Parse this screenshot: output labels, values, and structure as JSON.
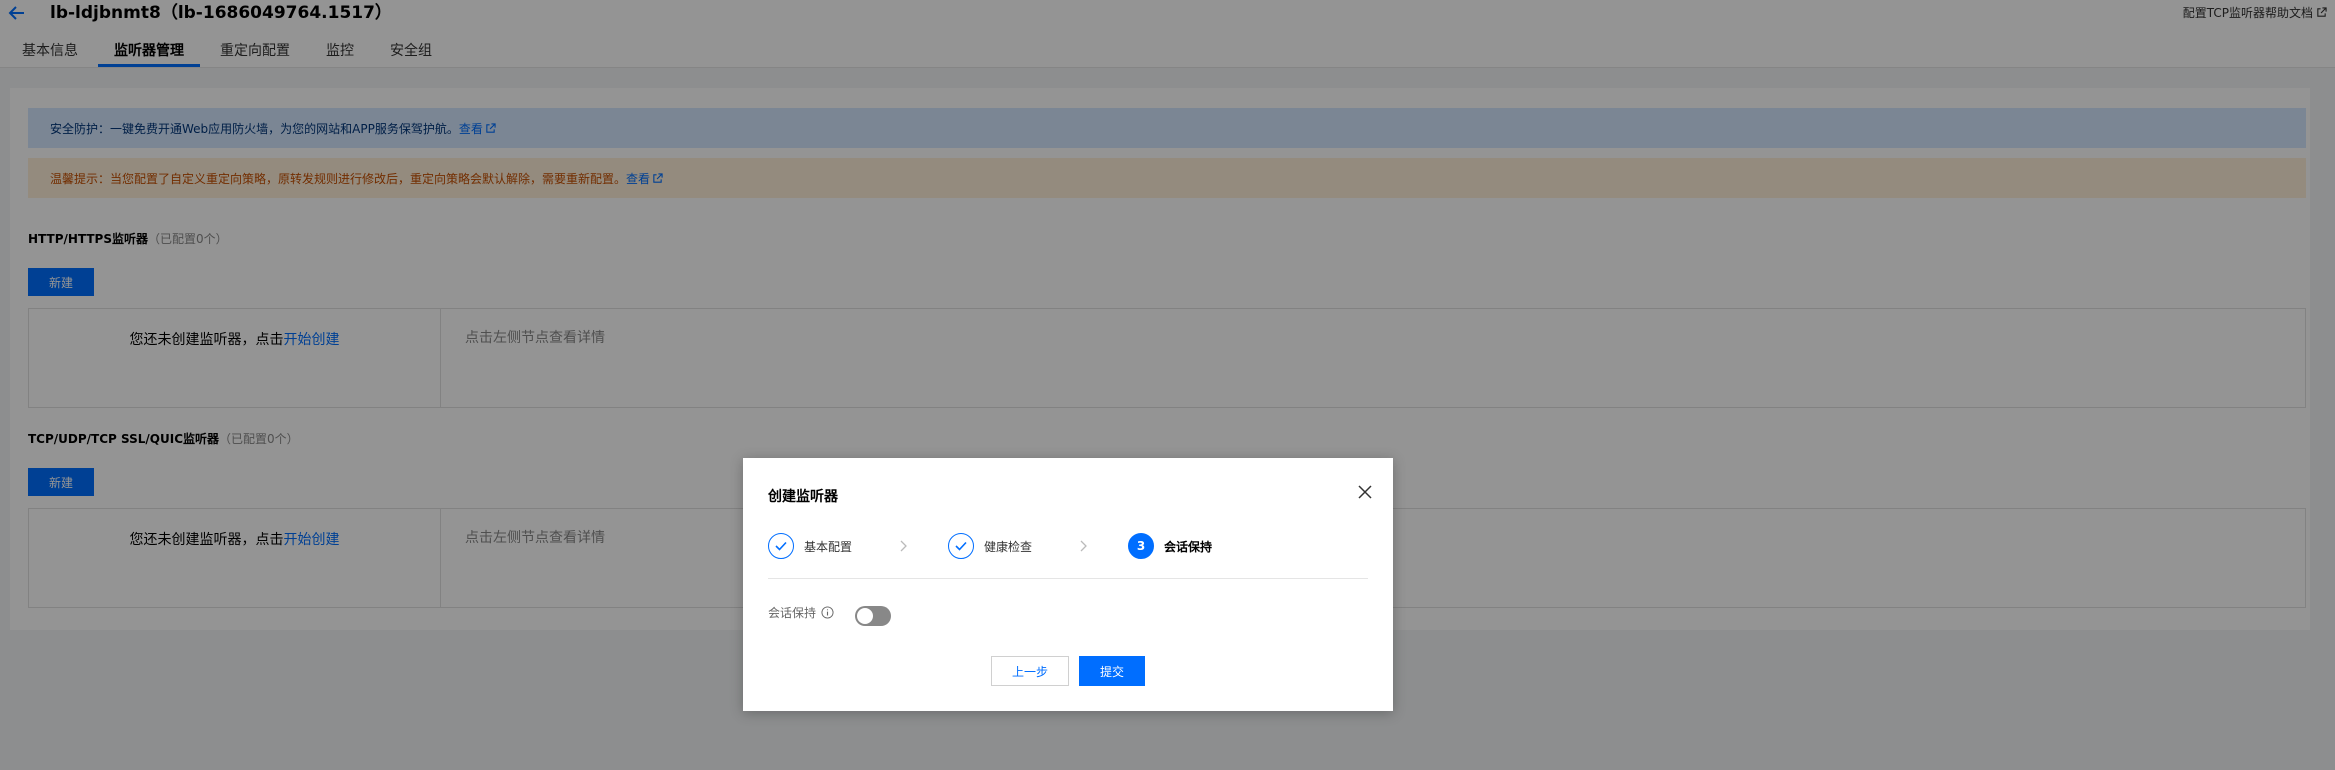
{
  "header": {
    "title": "lb-ldjbnmt8（lb-1686049764.1517）",
    "help_link": "配置TCP监听器帮助文档"
  },
  "tabs": [
    {
      "label": "基本信息",
      "active": false
    },
    {
      "label": "监听器管理",
      "active": true
    },
    {
      "label": "重定向配置",
      "active": false
    },
    {
      "label": "监控",
      "active": false
    },
    {
      "label": "安全组",
      "active": false
    }
  ],
  "alerts": {
    "info_text": "安全防护：一键免费开通Web应用防火墙，为您的网站和APP服务保驾护航。",
    "info_link": "查看",
    "warn_text": "温馨提示：当您配置了自定义重定向策略，原转发规则进行修改后，重定向策略会默认解除，需要重新配置。",
    "warn_link": "查看"
  },
  "sections": [
    {
      "title": "HTTP/HTTPS监听器",
      "count": "（已配置0个）",
      "new_button": "新建",
      "empty_text": "您还未创建监听器，点击",
      "empty_link": "开始创建",
      "detail_placeholder": "点击左侧节点查看详情"
    },
    {
      "title": "TCP/UDP/TCP SSL/QUIC监听器",
      "count": "（已配置0个）",
      "new_button": "新建",
      "empty_text": "您还未创建监听器，点击",
      "empty_link": "开始创建",
      "detail_placeholder": "点击左侧节点查看详情"
    }
  ],
  "modal": {
    "title": "创建监听器",
    "steps": [
      {
        "label": "基本配置",
        "status": "done"
      },
      {
        "label": "健康检查",
        "status": "done"
      },
      {
        "label": "会话保持",
        "status": "current",
        "number": "3"
      }
    ],
    "field_label": "会话保持",
    "toggle_on": false,
    "prev_button": "上一步",
    "submit_button": "提交"
  },
  "colors": {
    "primary": "#006eff",
    "info_bg": "#d5e7ff",
    "warn_bg": "#fff0da",
    "warn_text": "#c54e00"
  }
}
